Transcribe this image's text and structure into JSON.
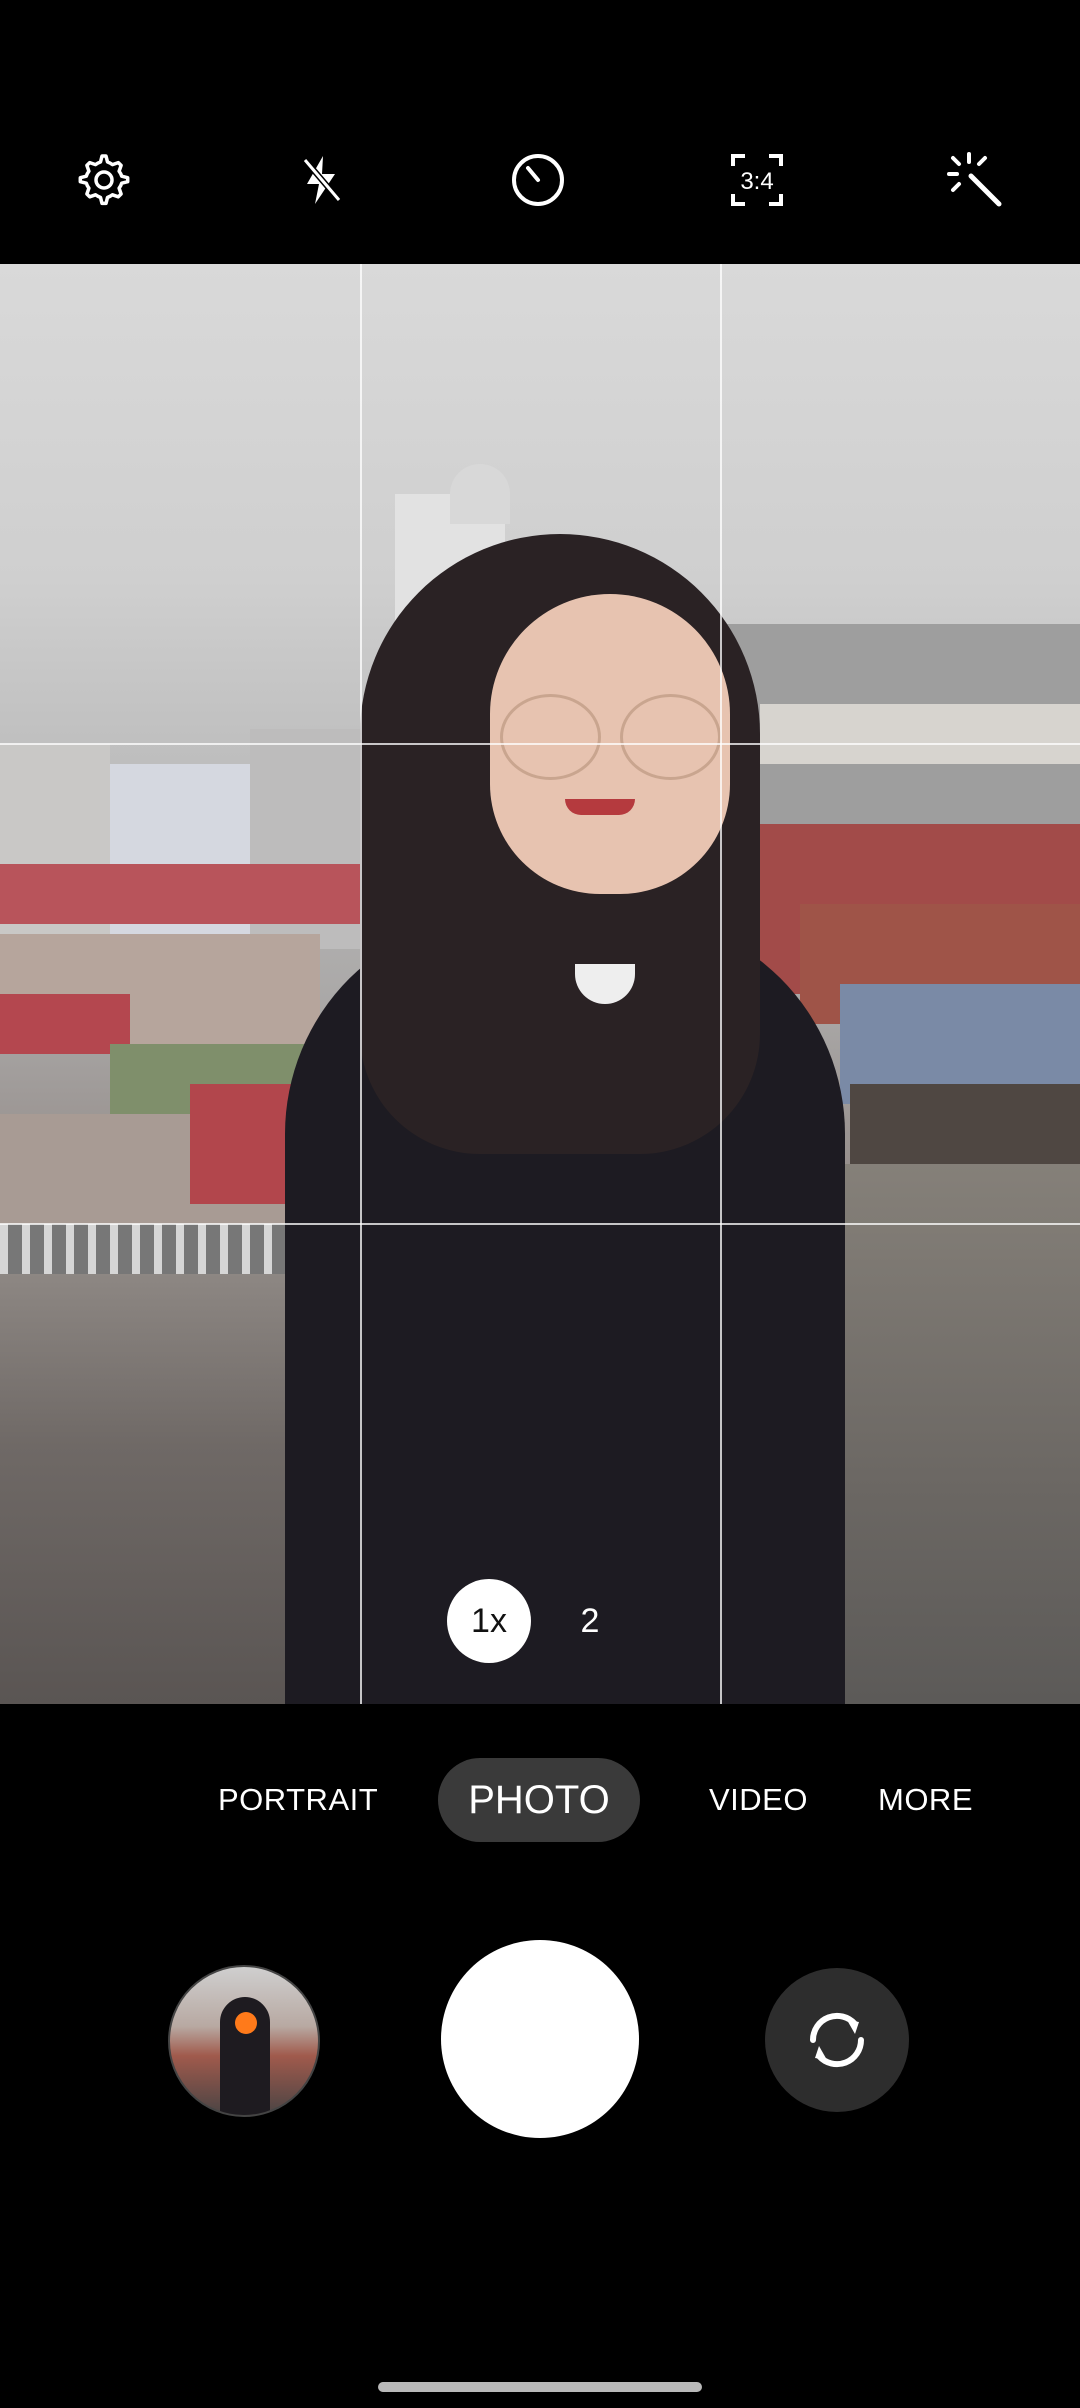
{
  "top_bar": {
    "settings_icon": "gear-icon",
    "flash_icon": "flash-off-icon",
    "timer_icon": "timer-icon",
    "aspect_ratio_label": "3:4",
    "effects_icon": "magic-wand-icon"
  },
  "zoom": {
    "active_label": "1x",
    "secondary_label": "2"
  },
  "modes": {
    "portrait": "PORTRAIT",
    "photo": "PHOTO",
    "video": "VIDEO",
    "more": "MORE"
  },
  "controls": {
    "gallery_icon": "gallery-thumbnail",
    "shutter_icon": "shutter-button",
    "switch_icon": "switch-camera-icon"
  }
}
